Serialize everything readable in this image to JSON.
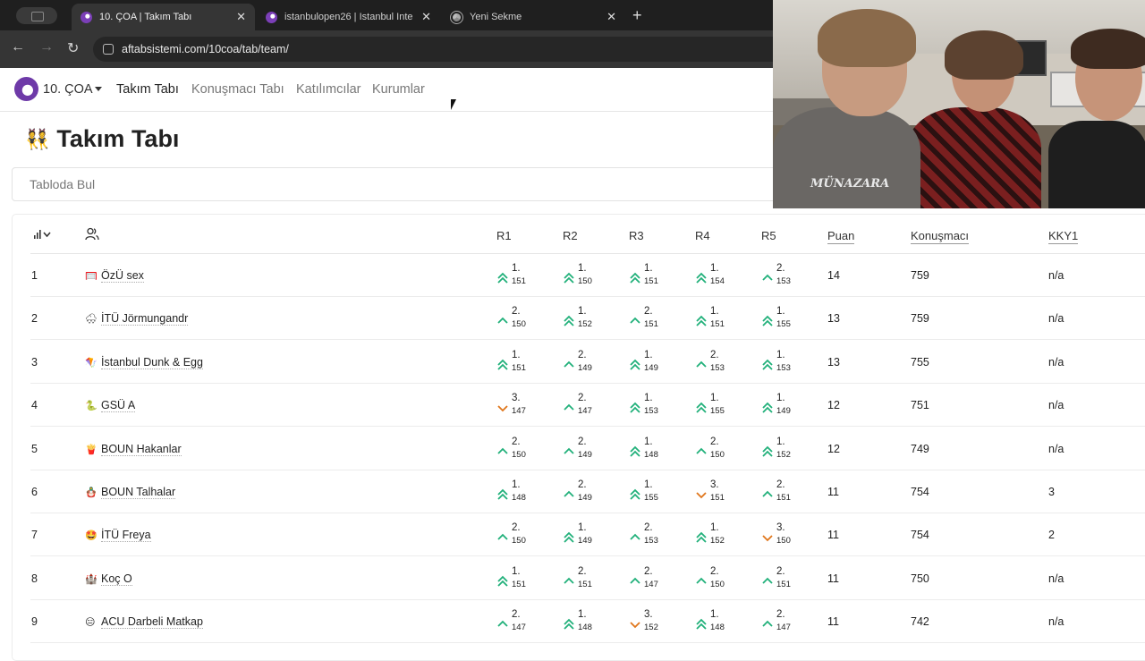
{
  "browser": {
    "tabs": [
      {
        "title": "10. ÇOA | Takım Tabı",
        "active": true
      },
      {
        "title": "istanbulopen26 | Istanbul Inte",
        "active": false
      },
      {
        "title": "Yeni Sekme",
        "active": false
      }
    ],
    "url": "aftabsistemi.com/10coa/tab/team/"
  },
  "nav": {
    "brand": "10. ÇOA",
    "links": [
      "Takım Tabı",
      "Konuşmacı Tabı",
      "Katılımcılar",
      "Kurumlar"
    ]
  },
  "page": {
    "title": "Takım Tabı",
    "title_emoji": "👯",
    "search_placeholder": "Tabloda Bul"
  },
  "table": {
    "columns": [
      "R1",
      "R2",
      "R3",
      "R4",
      "R5",
      "Puan",
      "Konuşmacı",
      "KKY1"
    ],
    "rows": [
      {
        "rank": "1",
        "emoji": "🥅",
        "team": "ÖzÜ sex",
        "results": [
          [
            "1.",
            "151",
            "up2"
          ],
          [
            "1.",
            "150",
            "up2"
          ],
          [
            "1.",
            "151",
            "up2"
          ],
          [
            "1.",
            "154",
            "up2"
          ],
          [
            "2.",
            "153",
            "up"
          ]
        ],
        "puan": "14",
        "konusmaci": "759",
        "kky1": "n/a"
      },
      {
        "rank": "2",
        "emoji": "🌨",
        "team": "İTÜ Jörmungandr",
        "results": [
          [
            "2.",
            "150",
            "up"
          ],
          [
            "1.",
            "152",
            "up2"
          ],
          [
            "2.",
            "151",
            "up"
          ],
          [
            "1.",
            "151",
            "up2"
          ],
          [
            "1.",
            "155",
            "up2"
          ]
        ],
        "puan": "13",
        "konusmaci": "759",
        "kky1": "n/a"
      },
      {
        "rank": "3",
        "emoji": "🪁",
        "team": "İstanbul Dunk & Egg",
        "results": [
          [
            "1.",
            "151",
            "up2"
          ],
          [
            "2.",
            "149",
            "up"
          ],
          [
            "1.",
            "149",
            "up2"
          ],
          [
            "2.",
            "153",
            "up"
          ],
          [
            "1.",
            "153",
            "up2"
          ]
        ],
        "puan": "13",
        "konusmaci": "755",
        "kky1": "n/a"
      },
      {
        "rank": "4",
        "emoji": "🐍",
        "team": "GSÜ A",
        "results": [
          [
            "3.",
            "147",
            "down"
          ],
          [
            "2.",
            "147",
            "up"
          ],
          [
            "1.",
            "153",
            "up2"
          ],
          [
            "1.",
            "155",
            "up2"
          ],
          [
            "1.",
            "149",
            "up2"
          ]
        ],
        "puan": "12",
        "konusmaci": "751",
        "kky1": "n/a"
      },
      {
        "rank": "5",
        "emoji": "🍟",
        "team": "BOUN Hakanlar",
        "results": [
          [
            "2.",
            "150",
            "up"
          ],
          [
            "2.",
            "149",
            "up"
          ],
          [
            "1.",
            "148",
            "up2"
          ],
          [
            "2.",
            "150",
            "up"
          ],
          [
            "1.",
            "152",
            "up2"
          ]
        ],
        "puan": "12",
        "konusmaci": "749",
        "kky1": "n/a"
      },
      {
        "rank": "6",
        "emoji": "🪆",
        "team": "BOUN Talhalar",
        "results": [
          [
            "1.",
            "148",
            "up2"
          ],
          [
            "2.",
            "149",
            "up"
          ],
          [
            "1.",
            "155",
            "up2"
          ],
          [
            "3.",
            "151",
            "down"
          ],
          [
            "2.",
            "151",
            "up"
          ]
        ],
        "puan": "11",
        "konusmaci": "754",
        "kky1": "3"
      },
      {
        "rank": "7",
        "emoji": "🤩",
        "team": "İTÜ Freya",
        "results": [
          [
            "2.",
            "150",
            "up"
          ],
          [
            "1.",
            "149",
            "up2"
          ],
          [
            "2.",
            "153",
            "up"
          ],
          [
            "1.",
            "152",
            "up2"
          ],
          [
            "3.",
            "150",
            "down"
          ]
        ],
        "puan": "11",
        "konusmaci": "754",
        "kky1": "2"
      },
      {
        "rank": "8",
        "emoji": "🏰",
        "team": "Koç O",
        "results": [
          [
            "1.",
            "151",
            "up2"
          ],
          [
            "2.",
            "151",
            "up"
          ],
          [
            "2.",
            "147",
            "up"
          ],
          [
            "2.",
            "150",
            "up"
          ],
          [
            "2.",
            "151",
            "up"
          ]
        ],
        "puan": "11",
        "konusmaci": "750",
        "kky1": "n/a"
      },
      {
        "rank": "9",
        "emoji": "😑",
        "team": "ACU Darbeli Matkap",
        "results": [
          [
            "2.",
            "147",
            "up"
          ],
          [
            "1.",
            "148",
            "up2"
          ],
          [
            "3.",
            "152",
            "down"
          ],
          [
            "1.",
            "148",
            "up2"
          ],
          [
            "2.",
            "147",
            "up"
          ]
        ],
        "puan": "11",
        "konusmaci": "742",
        "kky1": "n/a"
      }
    ]
  },
  "webcam": {
    "shirt_text": "MÜNAZARA"
  },
  "colors": {
    "up": "#21b07a",
    "down": "#e0761b",
    "brand": "#6e3aa8"
  }
}
